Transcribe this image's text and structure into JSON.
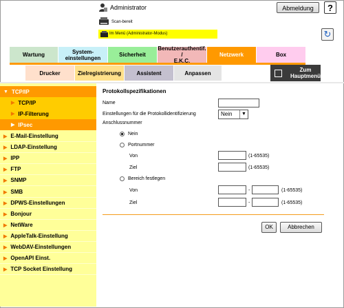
{
  "header": {
    "user_label": "Administrator",
    "logout_label": "Abmeldung",
    "help_label": "?",
    "scan_status": "Scan-bereit",
    "mode_status": "Im Menü (Administrator-Modus)"
  },
  "tabs": [
    {
      "label": "Wartung",
      "color": "#cce6cc"
    },
    {
      "label": "System-\neinstellungen",
      "color": "#c8f0f8"
    },
    {
      "label": "Sicherheit",
      "color": "#99ee99"
    },
    {
      "label": "Benutzerauthentif. /\nE.K.C.",
      "color": "#f2b8b8"
    },
    {
      "label": "Netzwerk",
      "color": "#ff9900",
      "active": true
    },
    {
      "label": "Box",
      "color": "#ffccee"
    }
  ],
  "subtabs": [
    {
      "label": "Drucker",
      "color": "#ffe0cc"
    },
    {
      "label": "Zielregistrierung",
      "color": "#ffe08a"
    },
    {
      "label": "Assistent",
      "color": "#c4c0cf"
    },
    {
      "label": "Anpassen",
      "color": "#e4e4e4"
    }
  ],
  "home_label": "Zum\nHauptmenü",
  "sidebar": {
    "items": [
      {
        "label": "TCP/IP",
        "level": 0,
        "state": "open"
      },
      {
        "label": "TCP/IP",
        "level": 1,
        "state": "sub"
      },
      {
        "label": "IP-Filterung",
        "level": 1,
        "state": "sub"
      },
      {
        "label": "IPsec",
        "level": 1,
        "state": "selected"
      },
      {
        "label": "E-Mail-Einstellung",
        "level": 0
      },
      {
        "label": "LDAP-Einstellung",
        "level": 0
      },
      {
        "label": "IPP",
        "level": 0
      },
      {
        "label": "FTP",
        "level": 0
      },
      {
        "label": "SNMP",
        "level": 0
      },
      {
        "label": "SMB",
        "level": 0
      },
      {
        "label": "DPWS-Einstellungen",
        "level": 0
      },
      {
        "label": "Bonjour",
        "level": 0
      },
      {
        "label": "NetWare",
        "level": 0
      },
      {
        "label": "AppleTalk-Einstellung",
        "level": 0
      },
      {
        "label": "WebDAV-Einstellungen",
        "level": 0
      },
      {
        "label": "OpenAPI Einst.",
        "level": 0
      },
      {
        "label": "TCP Socket Einstellung",
        "level": 0
      }
    ]
  },
  "form": {
    "title": "Protokollspezifikationen",
    "name_label": "Name",
    "name_value": "",
    "protocol_label": "Einstellungen für die Protokollidentifizierung",
    "protocol_value": "Nein",
    "port_section_label": "Anschlussnummer",
    "radio_none": "Nein",
    "radio_port": "Portnummer",
    "from_label": "Von",
    "to_label": "Ziel",
    "range_hint": "(1-65535)",
    "radio_range": "Bereich festlegen",
    "dash": "-",
    "ok_label": "OK",
    "cancel_label": "Abbrechen"
  }
}
